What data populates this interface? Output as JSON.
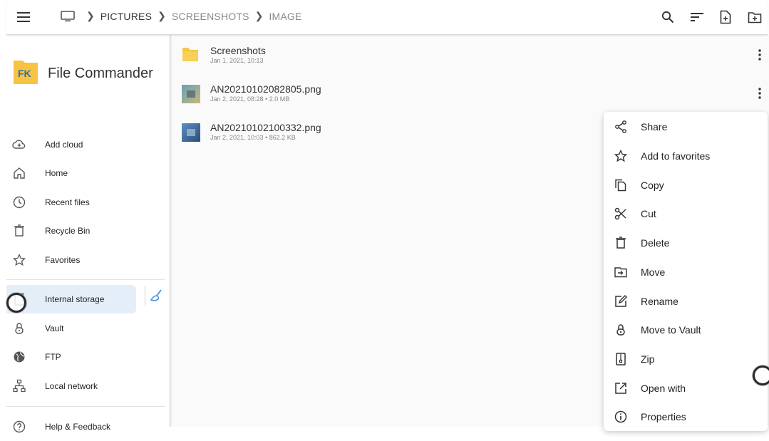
{
  "toolbar": {
    "menu_icon": "hamburger-menu-icon",
    "device_icon": "monitor-icon",
    "breadcrumbs": [
      "PICTURES",
      "SCREENSHOTS",
      "IMAGE"
    ],
    "actions": [
      "search-icon",
      "sort-icon",
      "new-file-icon",
      "new-folder-icon"
    ]
  },
  "sidebar": {
    "app_name": "File Commander",
    "logo_text": "FK",
    "items": [
      {
        "label": "Add cloud",
        "icon": "cloud-add-icon"
      },
      {
        "label": "Home",
        "icon": "home-icon"
      },
      {
        "label": "Recent files",
        "icon": "clock-icon"
      },
      {
        "label": "Recycle Bin",
        "icon": "trash-icon"
      },
      {
        "label": "Favorites",
        "icon": "star-icon"
      },
      {
        "label": "Internal storage",
        "icon": "storage-icon"
      },
      {
        "label": "Vault",
        "icon": "lock-icon"
      },
      {
        "label": "FTP",
        "icon": "globe-icon"
      },
      {
        "label": "Local network",
        "icon": "network-icon"
      },
      {
        "label": "Help & Feedback",
        "icon": "help-icon"
      }
    ],
    "active_item": "Internal storage",
    "clean_icon": "broom-icon"
  },
  "files": [
    {
      "name": "Screenshots",
      "meta": "Jan 1, 2021, 10:13",
      "type": "folder"
    },
    {
      "name": "AN20210102082805.png",
      "meta": "Jan 2, 2021, 08:28 • 2.0 MB",
      "type": "image"
    },
    {
      "name": "AN20210102100332.png",
      "meta": "Jan 2, 2021, 10:03 • 862.2 KB",
      "type": "image"
    }
  ],
  "context_menu": {
    "items": [
      {
        "label": "Share",
        "icon": "share-icon"
      },
      {
        "label": "Add to favorites",
        "icon": "star-icon"
      },
      {
        "label": "Copy",
        "icon": "copy-icon"
      },
      {
        "label": "Cut",
        "icon": "scissors-icon"
      },
      {
        "label": "Delete",
        "icon": "trash-icon"
      },
      {
        "label": "Move",
        "icon": "move-icon"
      },
      {
        "label": "Rename",
        "icon": "edit-icon"
      },
      {
        "label": "Move to Vault",
        "icon": "lock-icon"
      },
      {
        "label": "Zip",
        "icon": "zip-icon"
      },
      {
        "label": "Open with",
        "icon": "open-external-icon"
      },
      {
        "label": "Properties",
        "icon": "info-icon"
      }
    ]
  },
  "colors": {
    "accent": "#4a90d9",
    "folder": "#f6c343",
    "logo_bg": "#f6c343",
    "logo_text": "#2b6fb8"
  }
}
